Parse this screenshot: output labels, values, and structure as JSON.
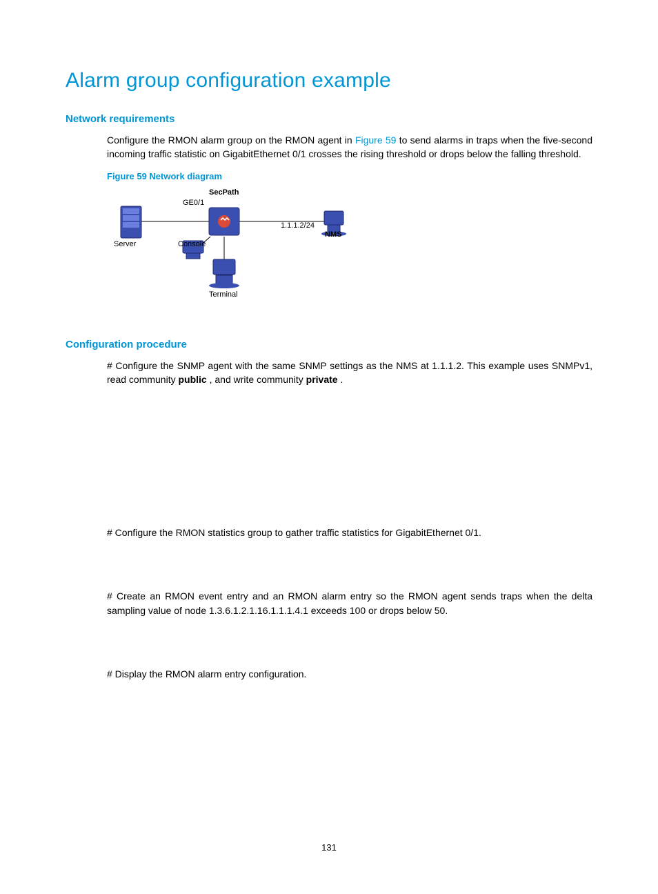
{
  "title": "Alarm group configuration example",
  "sections": {
    "network_requirements": {
      "heading": "Network requirements",
      "paragraph_pre": "Configure the RMON alarm group on the RMON agent in ",
      "figure_link": "Figure 59",
      "paragraph_post": " to send alarms in traps when the five-second incoming traffic statistic on GigabitEthernet 0/1 crosses the rising threshold or drops below the falling threshold.",
      "figure_caption": "Figure 59 Network diagram"
    },
    "configuration_procedure": {
      "heading": "Configuration procedure",
      "p1_pre": "# Configure the SNMP agent with the same SNMP settings as the NMS at 1.1.1.2. This example uses SNMPv1, read community ",
      "p1_b1": "public",
      "p1_mid": ", and write community ",
      "p1_b2": "private",
      "p1_post": ".",
      "p2": "# Configure the RMON statistics group to gather traffic statistics for GigabitEthernet 0/1.",
      "p3": "# Create an RMON event entry and an RMON alarm entry so the RMON agent sends traps when the delta sampling value of node 1.3.6.1.2.1.16.1.1.1.4.1 exceeds 100 or drops below 50.",
      "p4": "# Display the RMON alarm entry configuration."
    }
  },
  "diagram": {
    "secpath": "SecPath",
    "ge": "GE0/1",
    "ip": "1.1.1.2/24",
    "nms": "NMS",
    "server": "Server",
    "console": "Console",
    "terminal": "Terminal"
  },
  "page_number": "131"
}
